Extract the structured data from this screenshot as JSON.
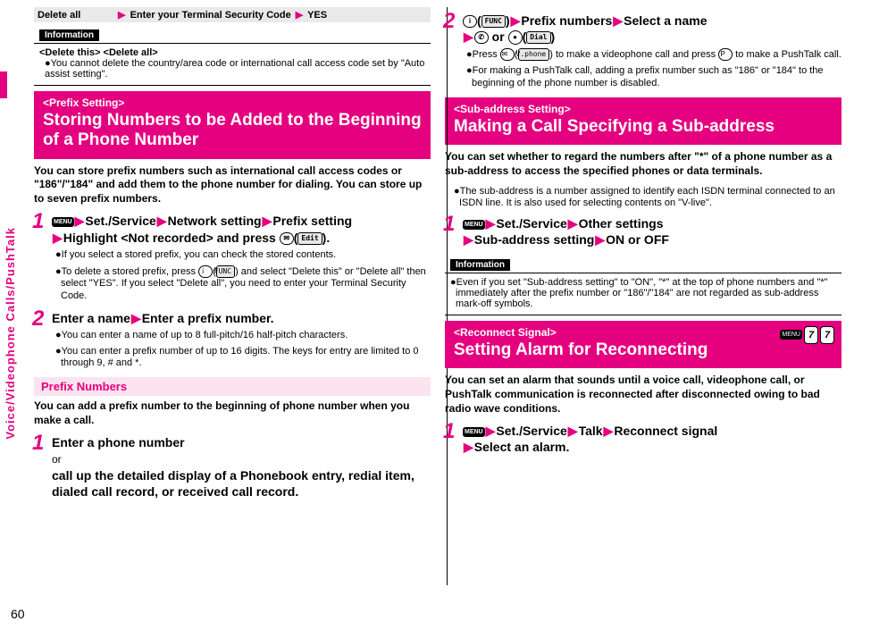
{
  "sidebar": {
    "label": "Voice/Videophone Calls/PushTalk"
  },
  "pageNumber": "60",
  "left": {
    "topbar": {
      "a": "Delete all",
      "b": "Enter your Terminal Security Code",
      "c": "YES"
    },
    "info1": {
      "tag": "Information",
      "sub": "<Delete this> <Delete all>",
      "body": "●You cannot delete the country/area code or international call access code set by \"Auto assist setting\"."
    },
    "prefixSetting": {
      "tag": "<Prefix Setting>",
      "title": "Storing Numbers to be Added to the Beginning of a Phone Number",
      "intro": "You can store prefix numbers such as international call access codes or \"186\"/\"184\" and add them to the phone number for dialing. You can store up to seven prefix numbers.",
      "step1": {
        "main_a": "Set./Service",
        "main_b": "Network setting",
        "main_c": "Prefix setting",
        "main_d": "Highlight <Not recorded> and press",
        "key_label": "Edit",
        "sub1": "●If you select a stored prefix, you can check the stored contents.",
        "sub2a": "●To delete a stored prefix, press",
        "sub2b": "and select \"Delete this\" or \"Delete all\" then select \"YES\". If you select \"Delete all\", you need to enter your Terminal Security Code.",
        "key_func": "FUNC"
      },
      "step2": {
        "main_a": "Enter a name",
        "main_b": "Enter a prefix number.",
        "sub1": "●You can enter a name of up to 8 full-pitch/16 half-pitch characters.",
        "sub2": "●You can enter a prefix number of up to 16 digits. The keys for entry are limited to 0 through 9, # and *."
      }
    },
    "prefixNumbers": {
      "tag": "Prefix Numbers",
      "intro": "You can add a prefix number to the beginning of phone number when you make a call.",
      "step1": {
        "main_a": "Enter a phone number",
        "or": "or",
        "main_b": "call up the detailed display of a Phonebook entry, redial item, dialed call record, or received call record."
      }
    }
  },
  "right": {
    "step2": {
      "func": "FUNC",
      "a": "Prefix numbers",
      "b": "Select a name",
      "or": "or",
      "dial": "Dial",
      "sub1a": "●Press",
      "sub1b_label": "V.phone",
      "sub1b": "to make a videophone call and press",
      "sub1c": "to make a PushTalk call.",
      "sub2": "●For making a PushTalk call, adding a prefix number such as \"186\" or \"184\" to the beginning of the phone number is disabled."
    },
    "subAddress": {
      "tag": "<Sub-address Setting>",
      "title": "Making a Call Specifying a Sub-address",
      "intro": "You can set whether to regard the numbers after \"*\" of a phone number as a sub-address to access the specified phones or data terminals.",
      "bullet": "●The sub-address is a number assigned to identify each ISDN terminal connected to an ISDN line. It is also used for selecting contents on \"V-live\".",
      "step1": {
        "a": "Set./Service",
        "b": "Other settings",
        "c": "Sub-address setting",
        "d": "ON or OFF"
      }
    },
    "info2": {
      "tag": "Information",
      "body": "●Even if you set \"Sub-address setting\" to \"ON\", \"*\" at the top of phone numbers and \"*\" immediately after the prefix number or \"186\"/\"184\" are not regarded as sub-address mark-off symbols."
    },
    "reconnect": {
      "tag": "<Reconnect Signal>",
      "title": "Setting Alarm for Reconnecting",
      "badge": {
        "menu": "MENU",
        "n1": "7",
        "n2": "7"
      },
      "intro": "You can set an alarm that sounds until a voice call, videophone call, or PushTalk communication is reconnected after disconnected owing to bad radio wave conditions.",
      "step1": {
        "a": "Set./Service",
        "b": "Talk",
        "c": "Reconnect signal",
        "d": "Select an alarm."
      }
    }
  }
}
